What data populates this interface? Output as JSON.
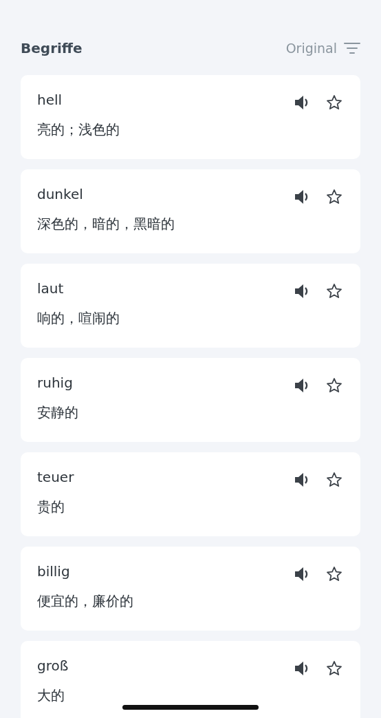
{
  "header": {
    "title": "Begriffe",
    "sort_label": "Original"
  },
  "terms": [
    {
      "word": "hell",
      "translation": "亮的；浅色的",
      "starred": false
    },
    {
      "word": "dunkel",
      "translation": "深色的，暗的，黑暗的",
      "starred": false
    },
    {
      "word": "laut",
      "translation": "响的，喧闹的",
      "starred": false
    },
    {
      "word": "ruhig",
      "translation": "安静的",
      "starred": false
    },
    {
      "word": "teuer",
      "translation": "贵的",
      "starred": false
    },
    {
      "word": "billig",
      "translation": "便宜的，廉价的",
      "starred": false
    },
    {
      "word": "groß",
      "translation": "大的",
      "starred": false
    }
  ]
}
